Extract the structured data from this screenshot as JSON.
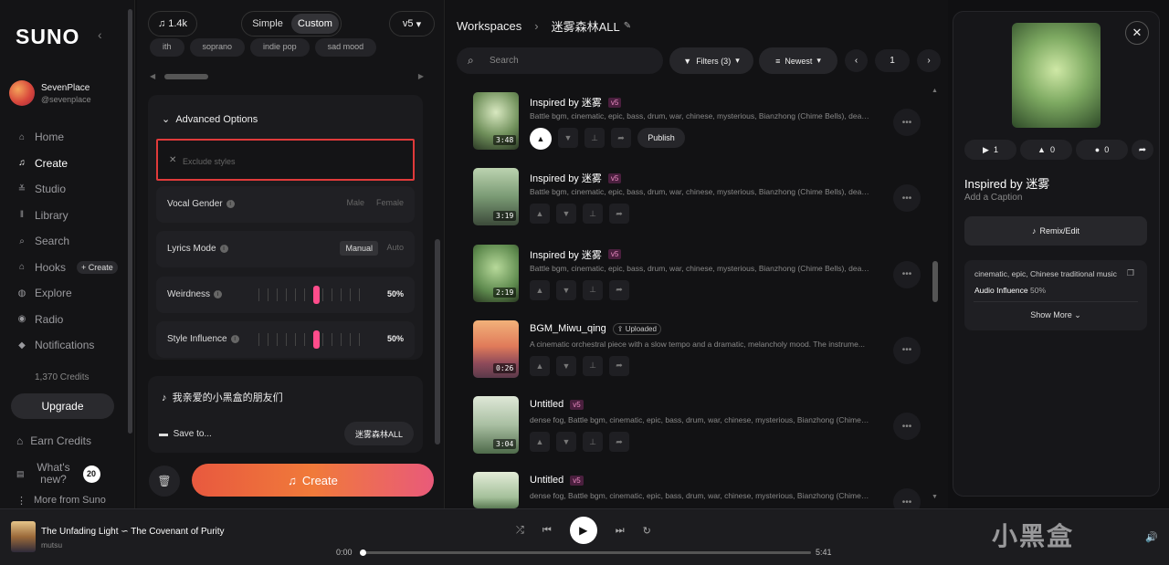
{
  "brand": "SUNO",
  "user": {
    "name": "SevenPlace",
    "handle": "@sevenplace"
  },
  "nav": [
    {
      "label": "Home",
      "icon": "⌂"
    },
    {
      "label": "Create",
      "icon": "♫"
    },
    {
      "label": "Studio",
      "icon": "≚"
    },
    {
      "label": "Library",
      "icon": "‖"
    },
    {
      "label": "Search",
      "icon": "⌕"
    },
    {
      "label": "Hooks",
      "icon": "⌂",
      "chip": "+ Create"
    },
    {
      "label": "Explore",
      "icon": "◍"
    },
    {
      "label": "Radio",
      "icon": "◉"
    },
    {
      "label": "Notifications",
      "icon": "◆"
    }
  ],
  "credits": "1,370 Credits",
  "upgrade": "Upgrade",
  "earn_credits": "Earn Credits",
  "whats_new": "What's new?",
  "whats_new_count": "20",
  "more_from": "More from Suno",
  "create_panel": {
    "song_count": "1.4k",
    "mode_simple": "Simple",
    "mode_custom": "Custom",
    "version": "v5",
    "tags": [
      "ith",
      "soprano",
      "indie pop",
      "sad mood"
    ],
    "advanced_title": "Advanced Options",
    "exclude_placeholder": "Exclude styles",
    "vocal_gender": "Vocal Gender",
    "male": "Male",
    "female": "Female",
    "lyrics_mode": "Lyrics Mode",
    "manual": "Manual",
    "auto": "Auto",
    "weirdness": "Weirdness",
    "weirdness_val": "50%",
    "style_influence": "Style Influence",
    "style_influence_val": "50%",
    "lyric_title": "我亲爱的小黑盒的朋友们",
    "save_to": "Save to...",
    "save_target": "迷雾森林ALL",
    "create_label": "Create"
  },
  "workspace": {
    "crumb_root": "Workspaces",
    "crumb_current": "迷雾森林ALL",
    "search_placeholder": "Search",
    "filters": "Filters (3)",
    "sort": "Newest",
    "page": "1"
  },
  "songs": [
    {
      "title": "Inspired by 迷雾",
      "badge": "v5",
      "desc": "Battle bgm, cinematic, epic, bass, drum, war, chinese, mysterious, Bianzhong (Chime Bells), death,...",
      "duration": "3:48",
      "publish": "Publish"
    },
    {
      "title": "Inspired by 迷雾",
      "badge": "v5",
      "desc": "Battle bgm, cinematic, epic, bass, drum, war, chinese, mysterious, Bianzhong (Chime Bells), death,...",
      "duration": "3:19"
    },
    {
      "title": "Inspired by 迷雾",
      "badge": "v5",
      "desc": "Battle bgm, cinematic, epic, bass, drum, war, chinese, mysterious, Bianzhong (Chime Bells), death,...",
      "duration": "2:19"
    },
    {
      "title": "BGM_Miwu_qing",
      "badge": "Uploaded",
      "desc": "A cinematic orchestral piece with a slow tempo and a dramatic, melancholy mood. The instrume...",
      "duration": "0:26"
    },
    {
      "title": "Untitled",
      "badge": "v5",
      "desc": "dense fog, Battle bgm, cinematic, epic, bass, drum, war, chinese, mysterious, Bianzhong (Chime B...",
      "duration": "3:04"
    },
    {
      "title": "Untitled",
      "badge": "v5",
      "desc": "dense fog, Battle bgm, cinematic, epic, bass, drum, war, chinese, mysterious, Bianzhong (Chime B...",
      "duration": ""
    }
  ],
  "detail": {
    "plays": "1",
    "likes": "0",
    "comments": "0",
    "title": "Inspired by 迷雾",
    "caption": "Add a Caption",
    "remix": "Remix/Edit",
    "styles": "cinematic, epic, Chinese traditional music",
    "audio_influence_label": "Audio Influence",
    "audio_influence_val": "50%",
    "show_more": "Show More"
  },
  "player": {
    "title": "The Unfading Light ∽ The Covenant of Purity",
    "artist": "mutsu",
    "current": "0:00",
    "total": "5:41",
    "progress": 0
  },
  "watermark": "小黑盒"
}
